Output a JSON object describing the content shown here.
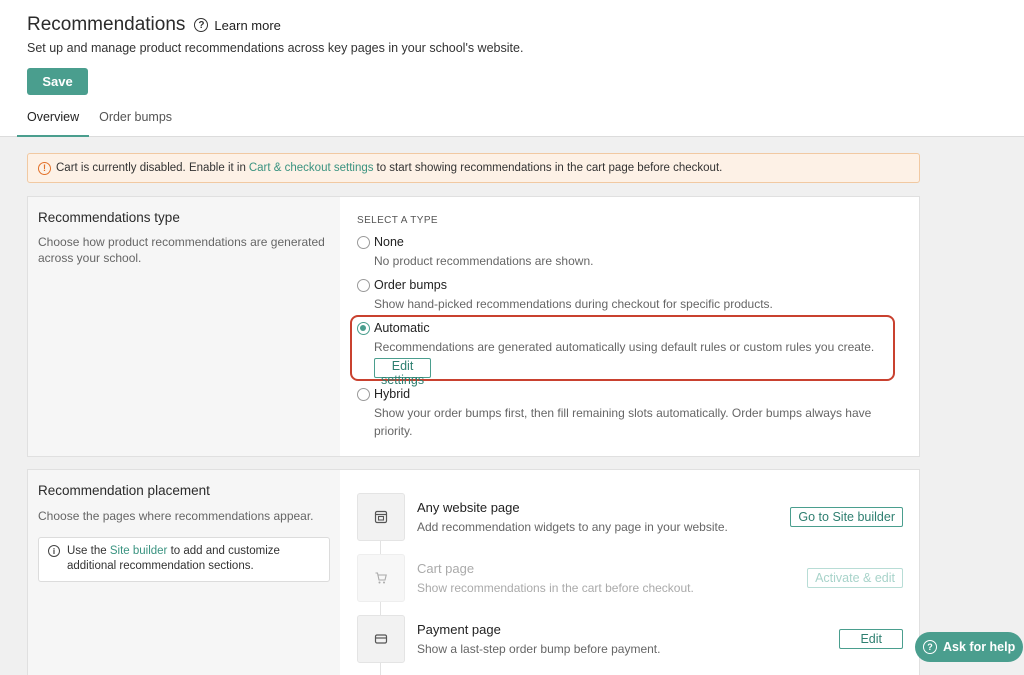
{
  "header": {
    "title": "Recommendations",
    "help_icon": "question-circle-icon",
    "learn_more": "Learn more",
    "subtitle": "Set up and manage product recommendations across key pages in your school's website.",
    "save_label": "Save",
    "tabs": [
      {
        "label": "Overview",
        "active": true
      },
      {
        "label": "Order bumps",
        "active": false
      }
    ]
  },
  "alert": {
    "icon": "alert-circle-icon",
    "text_before": "Cart is currently disabled. Enable it in",
    "link": "Cart & checkout settings",
    "text_after": "to start showing recommendations in the cart page before checkout."
  },
  "type_section": {
    "title": "Recommendations type",
    "description": "Choose how product recommendations are generated across your school.",
    "select_label": "SELECT A TYPE",
    "options": [
      {
        "label": "None",
        "description": "No product recommendations are shown.",
        "selected": false
      },
      {
        "label": "Order bumps",
        "description": "Show hand-picked recommendations during checkout for specific products.",
        "selected": false
      },
      {
        "label": "Automatic",
        "description": "Recommendations are generated automatically using default rules or custom rules you create.",
        "selected": true,
        "action": "Edit settings"
      },
      {
        "label": "Hybrid",
        "description": "Show your order bumps first, then fill remaining slots automatically. Order bumps always have priority.",
        "selected": false
      }
    ]
  },
  "placement_section": {
    "title": "Recommendation placement",
    "description": "Choose the pages where recommendations appear.",
    "info": {
      "icon": "info-circle-icon",
      "text_before": "Use the",
      "link": "Site builder",
      "text_after": "to add and customize additional recommendation sections."
    },
    "pages": [
      {
        "name": "Any website page",
        "description": "Add recommendation widgets to any page in your website.",
        "action": "Go to Site builder",
        "enabled": true,
        "icon": "webpage-icon"
      },
      {
        "name": "Cart page",
        "description": "Show recommendations in the cart before checkout.",
        "action": "Activate & edit",
        "enabled": false,
        "icon": "cart-icon"
      },
      {
        "name": "Payment page",
        "description": "Show a last-step order bump before payment.",
        "action": "Edit",
        "enabled": true,
        "icon": "credit-card-icon"
      }
    ]
  },
  "help_button": {
    "label": "Ask for help",
    "icon": "question-circle-icon"
  },
  "colors": {
    "accent": "#4a9e8e",
    "alert_bg": "#fdf1e6",
    "alert_icon": "#e2712a",
    "highlight_border": "#c9412f"
  }
}
